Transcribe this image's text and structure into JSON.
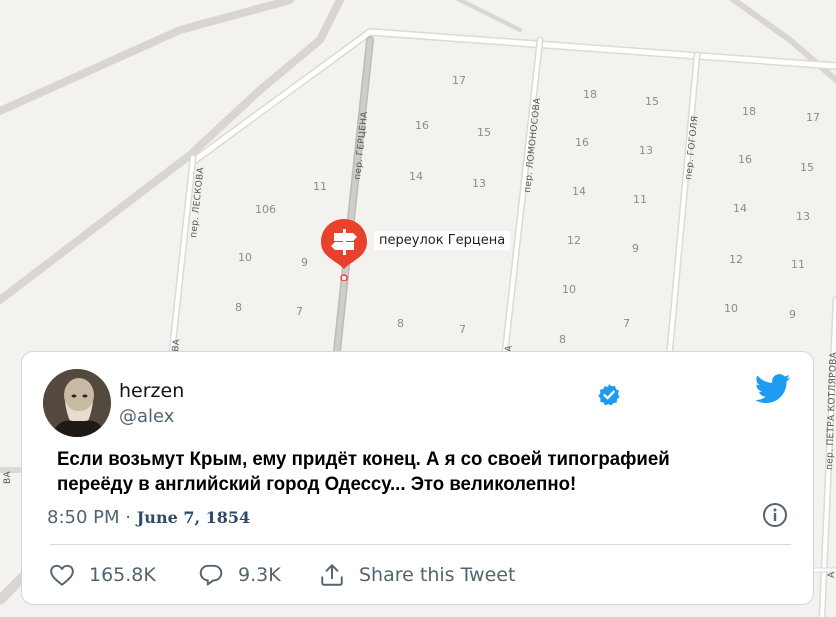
{
  "map": {
    "streets": {
      "leskova": "пер. ЛЕСКОВА",
      "gertsena": "пер. ГЕРЦЕНА",
      "lomonosova": "пер. ЛОМОНОСОВА",
      "gogolya": "пер. ГОГОЛЯ",
      "kotlyarova": "пер. ПЕТРА КОТЛЯРОВА",
      "cut_left": "ВА",
      "cut_left2": "ВА",
      "cut_mid": "А",
      "cut_mid2": "А"
    },
    "house_numbers": {
      "h17a": "17",
      "h16a": "16",
      "h15a": "15",
      "h14a": "14",
      "h13a": "13",
      "h11a": "11",
      "h106": "106",
      "h10a": "10",
      "h9a": "9",
      "h8a": "8",
      "h7a": "7",
      "h8b": "8",
      "h7b": "7",
      "h18b": "18",
      "h15b": "15",
      "h16b": "16",
      "h13b": "13",
      "h14b": "14",
      "h11b": "11",
      "h12b": "12",
      "h9b": "9",
      "h10b": "10",
      "h7c": "7",
      "h8c": "8",
      "h18c": "18",
      "h17c": "17",
      "h16c": "16",
      "h15c": "15",
      "h14c": "14",
      "h13c": "13",
      "h12c": "12",
      "h11c": "11",
      "h10c": "10",
      "h9c": "9"
    },
    "poi_label": "переулок Герцена",
    "poi_icon": "signpost-icon",
    "pin_color": "#e8412c"
  },
  "tweet": {
    "display_name": "herzen",
    "handle": "@alex",
    "text_line1": "Если возьмут Крым, ему придёт конец. А я со своей типографией",
    "text_line2": "переёду в английский город Одессу... Это великолепно!",
    "time": "8:50 PM",
    "separator": "·",
    "date": "June 7, 1854",
    "likes": "165.8K",
    "replies": "9.3K",
    "share_label": "Share this Tweet",
    "verified_color": "#1d9bf0",
    "bird_color": "#1d9bf0"
  }
}
